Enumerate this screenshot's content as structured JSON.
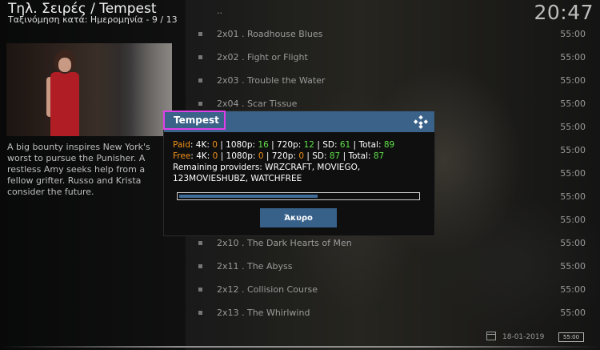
{
  "header": {
    "path": "Τηλ. Σειρές / Tempest",
    "sort_text": "Ταξινόμηση κατά: Ημερομηνία",
    "position": "9 / 13",
    "clock": "20:47"
  },
  "info": {
    "plot": "A big bounty inspires New York's worst to pursue the Punisher. A restless Amy seeks help from a fellow grifter. Russo and Krista consider the future."
  },
  "episodes": [
    {
      "title": "..",
      "runtime": ""
    },
    {
      "title": "2x01 . Roadhouse Blues",
      "runtime": "55:00"
    },
    {
      "title": "2x02 . Fight or Flight",
      "runtime": "55:00"
    },
    {
      "title": "2x03 . Trouble the Water",
      "runtime": "55:00"
    },
    {
      "title": "2x04 . Scar Tissue",
      "runtime": "55:00"
    },
    {
      "title": "",
      "runtime": "55:00"
    },
    {
      "title": "",
      "runtime": "55:00"
    },
    {
      "title": "",
      "runtime": "55:00"
    },
    {
      "title": "",
      "runtime": "55:00"
    },
    {
      "title": "",
      "runtime": "55:00"
    },
    {
      "title": "2x10 . The Dark Hearts of Men",
      "runtime": "55:00"
    },
    {
      "title": "2x11 . The Abyss",
      "runtime": "55:00"
    },
    {
      "title": "2x12 . Collision Course",
      "runtime": "55:00"
    },
    {
      "title": "2x13 . The Whirlwind",
      "runtime": "55:00"
    }
  ],
  "footer": {
    "date": "18-01-2019",
    "runtime": "55:00"
  },
  "dialog": {
    "title": "Tempest",
    "paid": {
      "label": "Paid",
      "k4": "0",
      "p1080": "16",
      "p720": "12",
      "sd": "61",
      "total": "89"
    },
    "free": {
      "label": "Free",
      "k4": "0",
      "p1080": "0",
      "p720": "0",
      "sd": "87",
      "total": "87"
    },
    "labels": {
      "k4": "4K:",
      "p1080": "1080p:",
      "p720": "720p:",
      "sd": "SD:",
      "total": "Total:"
    },
    "remaining": "Remaining providers: WRZCRAFT, MOVIEGO, 123MOVIESHUBZ, WATCHFREE",
    "progress": 0.58,
    "cancel_label": "Άκυρο"
  },
  "colors": {
    "accent_blue": "#3b6288",
    "title_outline": "#e03ee8",
    "paid_free_label": "#f0901a",
    "count_green": "#5fe04a"
  },
  "icons": {
    "dialog_logo": "kodi-icon",
    "footer_date": "calendar-icon"
  }
}
